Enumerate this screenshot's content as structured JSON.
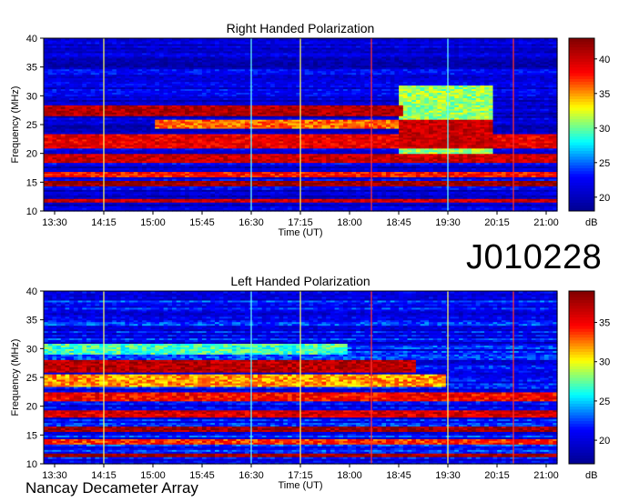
{
  "observation_id": "J010228",
  "credit": "Nancay Decameter Array",
  "chart_data": [
    {
      "type": "heatmap",
      "title": "Right Handed Polarization",
      "xlabel": "Time (UT)",
      "ylabel": "Frequency (MHz)",
      "x_ticks": [
        "13:30",
        "14:15",
        "15:00",
        "15:45",
        "16:30",
        "17:15",
        "18:00",
        "18:45",
        "19:30",
        "20:15",
        "21:00"
      ],
      "xlim": [
        "13:20",
        "21:10"
      ],
      "y_ticks": [
        10,
        15,
        20,
        25,
        30,
        35,
        40
      ],
      "ylim": [
        10,
        40
      ],
      "colorbar": {
        "unit": "dB",
        "ticks": [
          20,
          25,
          30,
          35,
          40
        ],
        "range": [
          18,
          43
        ]
      },
      "colorscale": [
        "#00008f",
        "#0000ff",
        "#00ffff",
        "#ffff00",
        "#ff0000",
        "#800000"
      ],
      "background_db": 21,
      "emission_bands": [
        {
          "f_min": 26.5,
          "f_max": 28.5,
          "t_start": "13:20",
          "t_end": "18:50",
          "db": 41
        },
        {
          "f_min": 24.5,
          "f_max": 26.0,
          "t_start": "15:00",
          "t_end": "18:50",
          "db": 36
        },
        {
          "f_min": 21.0,
          "f_max": 23.5,
          "t_start": "13:20",
          "t_end": "21:10",
          "db": 39
        },
        {
          "f_min": 18.5,
          "f_max": 20.0,
          "t_start": "13:20",
          "t_end": "21:10",
          "db": 40
        },
        {
          "f_min": 16.0,
          "f_max": 17.0,
          "t_start": "13:20",
          "t_end": "21:10",
          "db": 38
        },
        {
          "f_min": 14.5,
          "f_max": 15.2,
          "t_start": "13:20",
          "t_end": "21:10",
          "db": 42
        },
        {
          "f_min": 11.5,
          "f_max": 12.2,
          "t_start": "13:20",
          "t_end": "21:10",
          "db": 40
        },
        {
          "f_min": 20.0,
          "f_max": 32.0,
          "t_start": "18:45",
          "t_end": "20:10",
          "db": 31
        },
        {
          "f_min": 21.0,
          "f_max": 26.0,
          "t_start": "18:45",
          "t_end": "20:10",
          "db": 40
        }
      ],
      "interference_lines": [
        {
          "t": "14:15",
          "color": "#ffff66"
        },
        {
          "t": "16:30",
          "color": "#66ffff"
        },
        {
          "t": "17:15",
          "color": "#ffff66"
        },
        {
          "t": "18:20",
          "color": "#ff3333"
        },
        {
          "t": "19:30",
          "color": "#66ffff"
        },
        {
          "t": "20:30",
          "color": "#ff3333"
        }
      ]
    },
    {
      "type": "heatmap",
      "title": "Left Handed Polarization",
      "xlabel": "Time (UT)",
      "ylabel": "Frequency (MHz)",
      "x_ticks": [
        "13:30",
        "14:15",
        "15:00",
        "15:45",
        "16:30",
        "17:15",
        "18:00",
        "18:45",
        "19:30",
        "20:15",
        "21:00"
      ],
      "xlim": [
        "13:20",
        "21:10"
      ],
      "y_ticks": [
        10,
        15,
        20,
        25,
        30,
        35,
        40
      ],
      "ylim": [
        10,
        40
      ],
      "colorbar": {
        "unit": "dB",
        "ticks": [
          20,
          25,
          30,
          35
        ],
        "range": [
          17,
          39
        ]
      },
      "colorscale": [
        "#00008f",
        "#0000ff",
        "#00ffff",
        "#ffff00",
        "#ff0000",
        "#800000"
      ],
      "background_db": 21,
      "emission_bands": [
        {
          "f_min": 26.0,
          "f_max": 28.0,
          "t_start": "13:20",
          "t_end": "19:00",
          "db": 37
        },
        {
          "f_min": 23.5,
          "f_max": 25.5,
          "t_start": "13:20",
          "t_end": "19:30",
          "db": 32
        },
        {
          "f_min": 21.0,
          "f_max": 22.5,
          "t_start": "13:20",
          "t_end": "21:10",
          "db": 35
        },
        {
          "f_min": 18.0,
          "f_max": 19.5,
          "t_start": "13:20",
          "t_end": "21:10",
          "db": 36
        },
        {
          "f_min": 15.5,
          "f_max": 16.5,
          "t_start": "13:20",
          "t_end": "21:10",
          "db": 38
        },
        {
          "f_min": 13.5,
          "f_max": 14.3,
          "t_start": "13:20",
          "t_end": "21:10",
          "db": 34
        },
        {
          "f_min": 11.2,
          "f_max": 12.0,
          "t_start": "13:20",
          "t_end": "21:10",
          "db": 38
        },
        {
          "f_min": 29.0,
          "f_max": 31.0,
          "t_start": "13:20",
          "t_end": "18:00",
          "db": 27
        }
      ],
      "interference_lines": [
        {
          "t": "14:15",
          "color": "#ffff66"
        },
        {
          "t": "16:30",
          "color": "#66ffff"
        },
        {
          "t": "17:15",
          "color": "#ffff66"
        },
        {
          "t": "18:20",
          "color": "#ff3333"
        },
        {
          "t": "19:30",
          "color": "#ffff66"
        },
        {
          "t": "20:30",
          "color": "#ff3333"
        }
      ]
    }
  ]
}
